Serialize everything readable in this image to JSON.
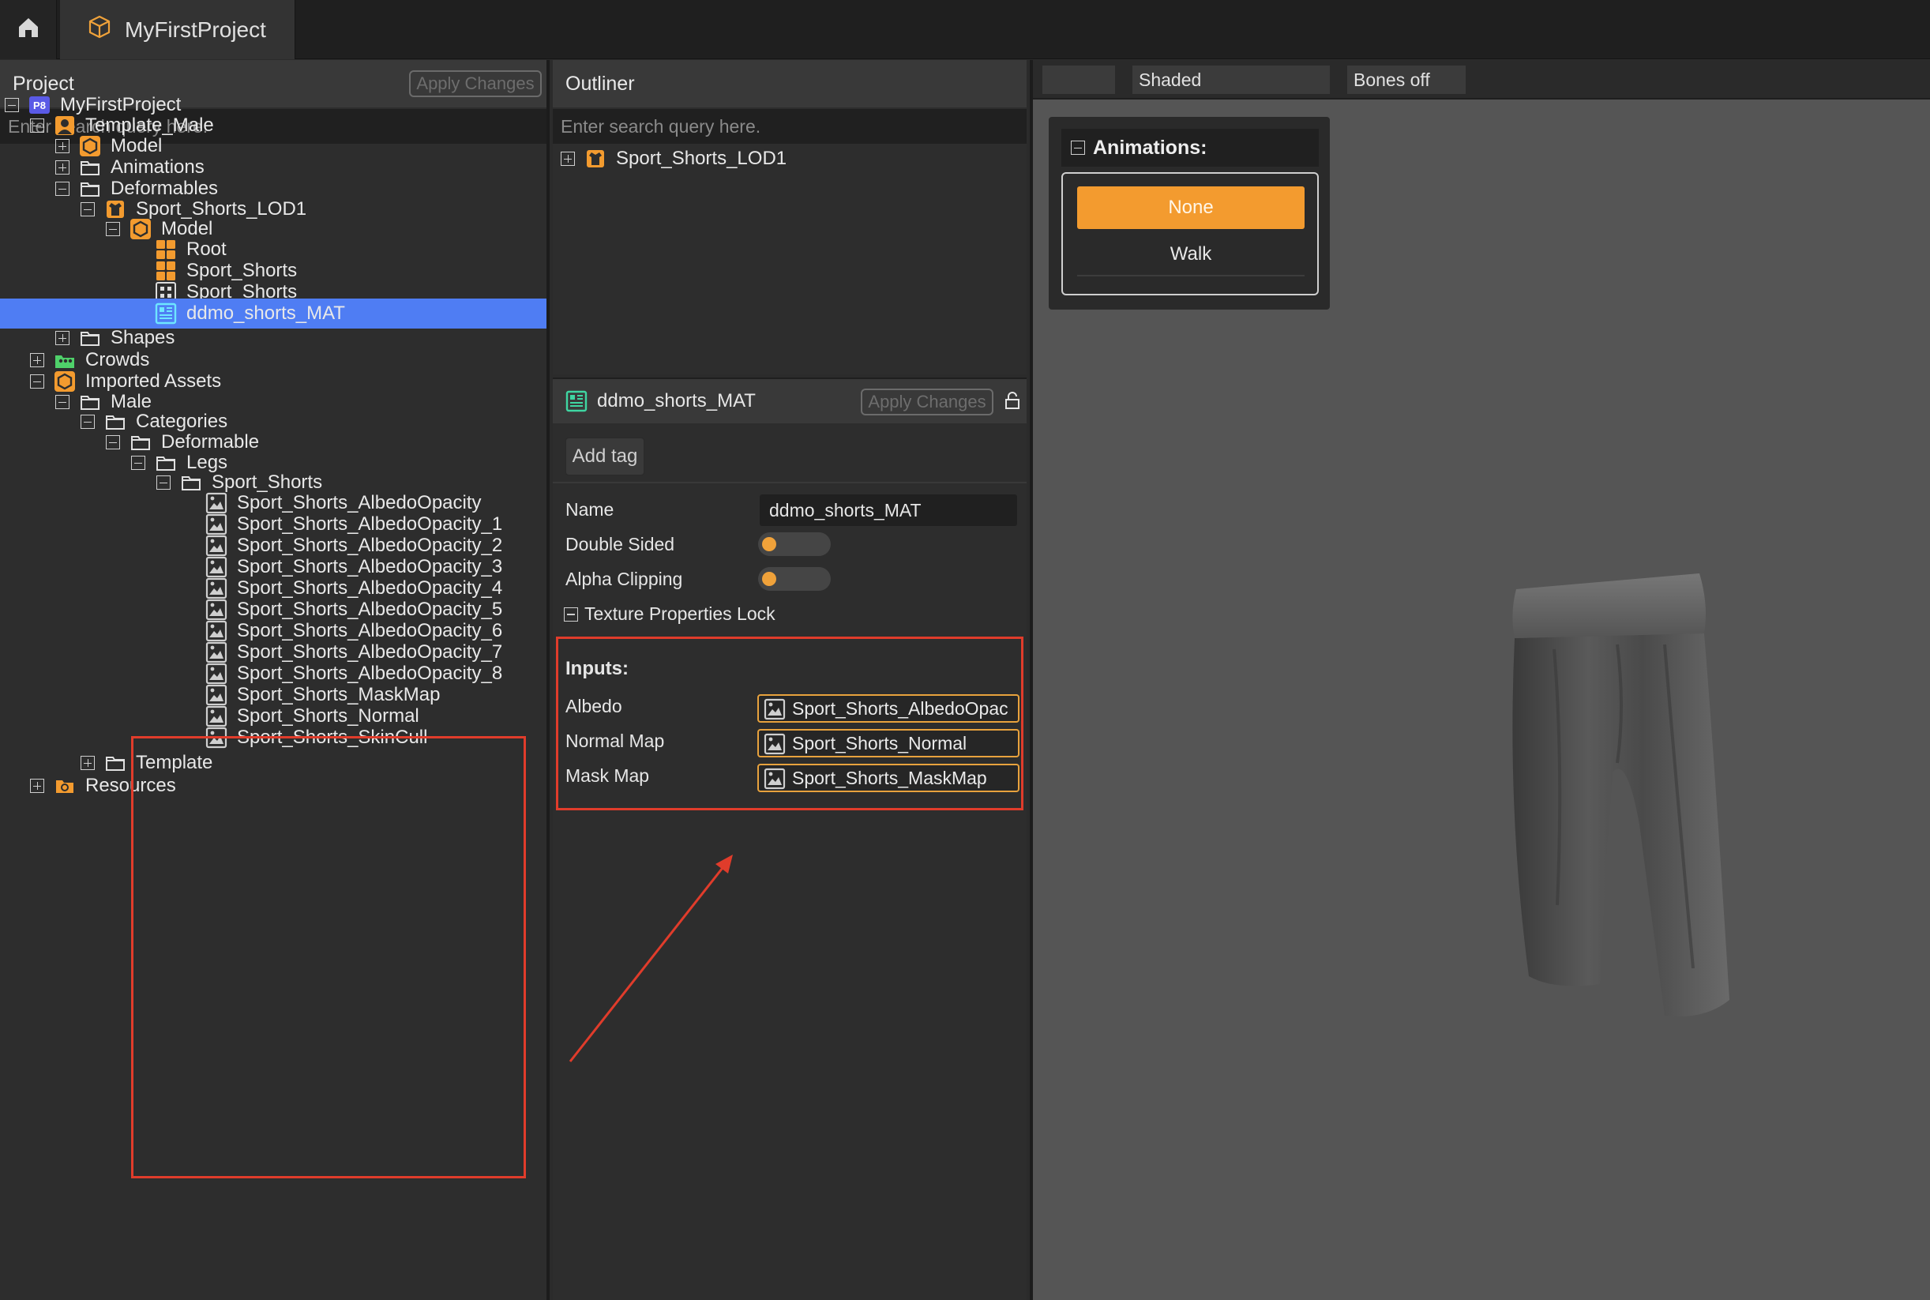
{
  "tabs": {
    "project_tab": "MyFirstProject"
  },
  "project": {
    "title": "Project",
    "apply_label": "Apply Changes",
    "search_placeholder": "Enter search query here.",
    "tree": [
      {
        "label": "MyFirstProject",
        "depth": 0,
        "toggle": "minus",
        "icon": "project-badge-icon"
      },
      {
        "label": "Template_Male",
        "depth": 1,
        "toggle": "minus",
        "icon": "character-icon"
      },
      {
        "label": "Model",
        "depth": 2,
        "toggle": "plus",
        "icon": "hexagon-model-icon"
      },
      {
        "label": "Animations",
        "depth": 2,
        "toggle": "plus",
        "icon": "folder-icon"
      },
      {
        "label": "Deformables",
        "depth": 2,
        "toggle": "minus",
        "icon": "folder-icon"
      },
      {
        "label": "Sport_Shorts_LOD1",
        "depth": 3,
        "toggle": "minus",
        "icon": "garment-icon"
      },
      {
        "label": "Model",
        "depth": 4,
        "toggle": "minus",
        "icon": "hexagon-model-icon"
      },
      {
        "label": "Root",
        "depth": 5,
        "toggle": "none",
        "icon": "mesh-grid-icon"
      },
      {
        "label": "Sport_Shorts",
        "depth": 5,
        "toggle": "none",
        "icon": "mesh-grid-icon"
      },
      {
        "label": "Sport_Shorts",
        "depth": 5,
        "toggle": "none",
        "icon": "dotted-grid-icon"
      },
      {
        "label": "ddmo_shorts_MAT",
        "depth": 5,
        "toggle": "none",
        "icon": "material-icon",
        "selected": true
      },
      {
        "label": "Shapes",
        "depth": 2,
        "toggle": "plus",
        "icon": "folder-icon"
      },
      {
        "label": "Crowds",
        "depth": 1,
        "toggle": "plus",
        "icon": "crowd-icon"
      },
      {
        "label": "Imported Assets",
        "depth": 1,
        "toggle": "minus",
        "icon": "hexagon-model-icon"
      },
      {
        "label": "Male",
        "depth": 2,
        "toggle": "minus",
        "icon": "folder-icon"
      },
      {
        "label": "Categories",
        "depth": 3,
        "toggle": "minus",
        "icon": "folder-icon"
      },
      {
        "label": "Deformable",
        "depth": 4,
        "toggle": "minus",
        "icon": "folder-icon"
      },
      {
        "label": "Legs",
        "depth": 5,
        "toggle": "minus",
        "icon": "folder-icon"
      },
      {
        "label": "Sport_Shorts",
        "depth": 6,
        "toggle": "minus",
        "icon": "folder-icon"
      },
      {
        "label": "Sport_Shorts_AlbedoOpacity",
        "depth": 7,
        "toggle": "none",
        "icon": "image-icon"
      },
      {
        "label": "Sport_Shorts_AlbedoOpacity_1",
        "depth": 7,
        "toggle": "none",
        "icon": "image-icon"
      },
      {
        "label": "Sport_Shorts_AlbedoOpacity_2",
        "depth": 7,
        "toggle": "none",
        "icon": "image-icon"
      },
      {
        "label": "Sport_Shorts_AlbedoOpacity_3",
        "depth": 7,
        "toggle": "none",
        "icon": "image-icon"
      },
      {
        "label": "Sport_Shorts_AlbedoOpacity_4",
        "depth": 7,
        "toggle": "none",
        "icon": "image-icon"
      },
      {
        "label": "Sport_Shorts_AlbedoOpacity_5",
        "depth": 7,
        "toggle": "none",
        "icon": "image-icon"
      },
      {
        "label": "Sport_Shorts_AlbedoOpacity_6",
        "depth": 7,
        "toggle": "none",
        "icon": "image-icon"
      },
      {
        "label": "Sport_Shorts_AlbedoOpacity_7",
        "depth": 7,
        "toggle": "none",
        "icon": "image-icon"
      },
      {
        "label": "Sport_Shorts_AlbedoOpacity_8",
        "depth": 7,
        "toggle": "none",
        "icon": "image-icon"
      },
      {
        "label": "Sport_Shorts_MaskMap",
        "depth": 7,
        "toggle": "none",
        "icon": "image-icon"
      },
      {
        "label": "Sport_Shorts_Normal",
        "depth": 7,
        "toggle": "none",
        "icon": "image-icon"
      },
      {
        "label": "Sport_Shorts_SkinCull",
        "depth": 7,
        "toggle": "none",
        "icon": "image-icon"
      },
      {
        "label": "Template",
        "depth": 3,
        "toggle": "plus",
        "icon": "folder-icon"
      },
      {
        "label": "Resources",
        "depth": 1,
        "toggle": "plus",
        "icon": "resources-folder-icon"
      }
    ]
  },
  "outliner": {
    "title": "Outliner",
    "search_placeholder": "Enter search query here.",
    "items": [
      {
        "label": "Sport_Shorts_LOD1",
        "icon": "garment-icon"
      }
    ]
  },
  "material": {
    "title": "ddmo_shorts_MAT",
    "apply_label": "Apply Changes",
    "add_tag_label": "Add tag",
    "name_label": "Name",
    "name_value": "ddmo_shorts_MAT",
    "double_sided_label": "Double Sided",
    "alpha_clipping_label": "Alpha Clipping",
    "texture_lock_label": "Texture Properties Lock",
    "inputs_title": "Inputs:",
    "inputs": [
      {
        "label": "Albedo",
        "value": "Sport_Shorts_AlbedoOpac"
      },
      {
        "label": "Normal Map",
        "value": "Sport_Shorts_Normal"
      },
      {
        "label": "Mask Map",
        "value": "Sport_Shorts_MaskMap"
      }
    ]
  },
  "viewport": {
    "shading_label": "Shaded",
    "bones_label": "Bones off",
    "animations_title": "Animations:",
    "animations": [
      {
        "label": "None",
        "active": true
      },
      {
        "label": "Walk",
        "active": false
      }
    ]
  },
  "colors": {
    "accent_orange": "#f39b2f",
    "selection_blue": "#4f7df3",
    "highlight_red": "#e03c2b",
    "field_border_orange": "#e8a23d"
  }
}
